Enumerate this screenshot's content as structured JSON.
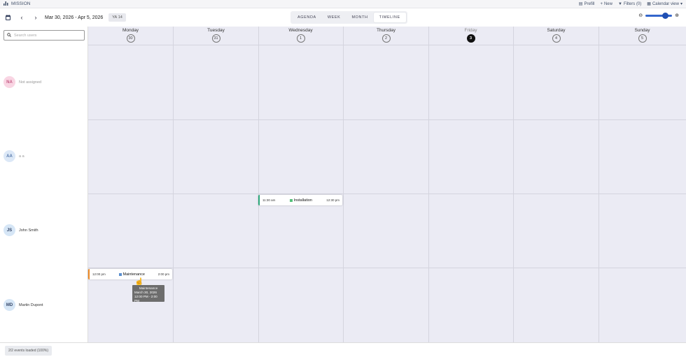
{
  "app": {
    "title": "MISSION"
  },
  "topbar": {
    "prefill": "Prefill",
    "new": "New",
    "filters": "Filters (0)",
    "calendar_view": "Calendar view"
  },
  "toolbar": {
    "date_range": "Mar 30, 2026 - Apr 5, 2026",
    "ya_label": "YA",
    "ya_count": "14",
    "tabs": [
      "AGENDA",
      "WEEK",
      "MONTH",
      "TIMELINE"
    ],
    "active_tab": "TIMELINE",
    "zoom_level": 0.75
  },
  "search": {
    "placeholder": "Search users"
  },
  "days": [
    {
      "name": "Monday",
      "num": "30"
    },
    {
      "name": "Tuesday",
      "num": "31"
    },
    {
      "name": "Wednesday",
      "num": "1"
    },
    {
      "name": "Thursday",
      "num": "2"
    },
    {
      "name": "Friday",
      "num": "3",
      "today": true
    },
    {
      "name": "Saturday",
      "num": "4"
    },
    {
      "name": "Sunday",
      "num": "5"
    }
  ],
  "users": [
    {
      "initials": "NA",
      "name": "Not assigned",
      "color": "#f9d5e3",
      "text": "#c45a84"
    },
    {
      "initials": "AA",
      "name": "a a",
      "color": "#dce8f7",
      "text": "#5577aa"
    },
    {
      "initials": "JS",
      "name": "John Smith",
      "color": "#d6e6f6",
      "text": "#334466"
    },
    {
      "initials": "MD",
      "name": "Martin Dupont",
      "color": "#d6e6f6",
      "text": "#334466"
    }
  ],
  "events": [
    {
      "title": "Installation",
      "start": "11:30 am",
      "end": "12:30 pm",
      "accent": "#2aa77a",
      "square": "#57c17b"
    },
    {
      "title": "Maintenance",
      "start": "12:00 pm",
      "end": "2:00 pm",
      "accent": "#f08a24",
      "square": "#5b8fcf"
    }
  ],
  "tooltip": {
    "title": "Maintenance",
    "date": "March 30, 2026",
    "time": "12:00 PM - 2:00 PM"
  },
  "status": "2/2 events loaded (100%)"
}
